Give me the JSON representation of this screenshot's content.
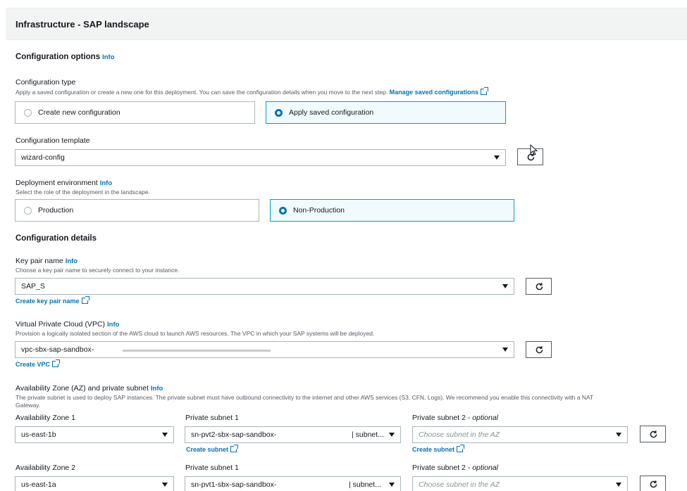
{
  "header": {
    "title": "Infrastructure - SAP landscape"
  },
  "config_options": {
    "title": "Configuration options",
    "info": "Info"
  },
  "config_type": {
    "label": "Configuration type",
    "desc": "Apply a saved configuration or create a new one for this deployment. You can save the configuration details when you move to the next step.",
    "manage_link": "Manage saved configurations",
    "options": [
      "Create new configuration",
      "Apply saved configuration"
    ],
    "selected": "Apply saved configuration"
  },
  "config_template": {
    "label": "Configuration template",
    "value": "wizard-config"
  },
  "deploy_env": {
    "label": "Deployment environment",
    "info": "Info",
    "desc": "Select the role of the deployment in the landscape.",
    "options": [
      "Production",
      "Non-Production"
    ],
    "selected": "Non-Production"
  },
  "config_details": {
    "title": "Configuration details"
  },
  "key_pair": {
    "label": "Key pair name",
    "info": "Info",
    "desc": "Choose a key pair name to securely connect to your instance.",
    "value": "SAP_S",
    "create_link": "Create key pair name"
  },
  "vpc": {
    "label": "Virtual Private Cloud (VPC)",
    "info": "Info",
    "desc": "Provision a logically isolated section of the AWS cloud to launch AWS resources. The VPC in which your SAP systems will be deployed.",
    "value": "vpc-sbx-sap-sandbox-",
    "create_link": "Create VPC"
  },
  "az_subnet": {
    "label": "Availability Zone (AZ) and private subnet",
    "info": "Info",
    "desc_line1": "The private subnet is used to deploy SAP instances. The private subnet must have outbound connectivity to the internet and other AWS services (S3, CFN, Logs). We recommend you enable this connectivity with a NAT",
    "desc_line2": "Gateway.",
    "rows": [
      {
        "az_label": "Availability Zone 1",
        "az_value": "us-east-1b",
        "subnet1_label": "Private subnet 1",
        "subnet1_value": "sn-pvt2-sbx-sap-sandbox-",
        "subnet1_suffix": "| subnet...",
        "subnet2_label": "Private subnet 2 - ",
        "subnet2_optional": "optional",
        "subnet2_placeholder": "Choose subnet in the AZ",
        "create_subnet": "Create subnet"
      },
      {
        "az_label": "Availability Zone 2",
        "az_value": "us-east-1a",
        "subnet1_label": "Private subnet 1",
        "subnet1_value": "sn-pvt1-sbx-sap-sandbox-",
        "subnet1_suffix": "| subnet...",
        "subnet2_label": "Private subnet 2 - ",
        "subnet2_optional": "optional",
        "subnet2_placeholder": "Choose subnet in the AZ"
      }
    ]
  }
}
